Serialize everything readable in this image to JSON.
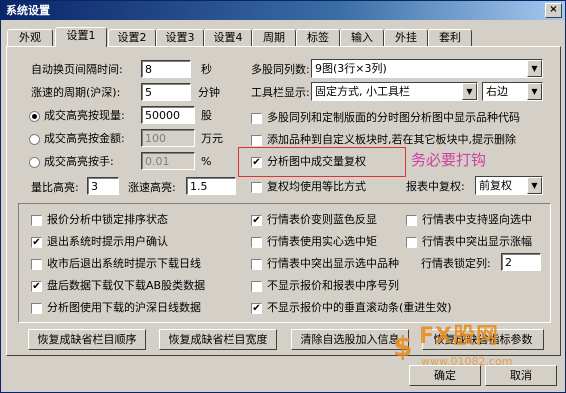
{
  "window": {
    "title": "系统设置",
    "close": "×"
  },
  "tabs": [
    "外观",
    "设置1",
    "设置2",
    "设置3",
    "设置4",
    "周期",
    "标签",
    "输入",
    "外挂",
    "套利"
  ],
  "left": {
    "refresh_label": "自动换页间隔时间:",
    "refresh_value": "8",
    "refresh_unit": "秒",
    "surge_label": "涨速的周期(沪深):",
    "surge_value": "5",
    "surge_unit": "分钟",
    "radio1_label": "成交高亮按现量:",
    "radio1_value": "50000",
    "radio1_unit": "股",
    "radio2_label": "成交高亮按金额:",
    "radio2_value": "100",
    "radio2_unit": "万元",
    "radio3_label": "成交高亮按手:",
    "radio3_value": "0.01",
    "radio3_unit": "%",
    "volratio_label": "量比高亮:",
    "volratio_value": "3",
    "surge_hl_label": "涨速高亮:",
    "surge_hl_value": "1.5"
  },
  "right": {
    "multi_label": "多股同列数:",
    "multi_value": "9图(3行×3列)",
    "toolbar_label": "工具栏显示:",
    "toolbar_value": "固定方式, 小工具栏",
    "toolbar_pos": "右边",
    "cb1": "多股同列和定制版面的分时图分析图中显示品种代码",
    "cb2": "添加品种到自定义板块时,若在其它板块中,提示删除",
    "cb3": "分析图中成交量复权",
    "cb4": "复权均使用等比方式",
    "fq_label": "报表中复权:",
    "fq_value": "前复权"
  },
  "annotation": "务必要打钩",
  "options": {
    "o1": "报价分析中锁定排序状态",
    "o2": "退出系统时提示用户确认",
    "o3": "收市后退出系统时提示下载日线",
    "o4": "盘后数据下载仅下载AB股类数据",
    "o5": "分析图使用下载的沪深日线数据",
    "o6": "行情表价变则蓝色反显",
    "o7": "行情表使用实心选中矩",
    "o8": "行情表中突出显示选中品种",
    "o9": "不显示报价和报表中序号列",
    "o10": "不显示报价中的垂直滚动条(重进生效)",
    "o11": "行情表中支持竖向选中",
    "o12": "行情表中突出显示涨幅",
    "lock_label": "行情表锁定列:",
    "lock_value": "2"
  },
  "buttons": {
    "b1": "恢复成缺省栏目顺序",
    "b2": "恢复成缺省栏目宽度",
    "b3": "清除自选股加入信息",
    "b4": "恢复成缺省指标参数",
    "ok": "确定",
    "cancel": "取消"
  },
  "watermark": {
    "brand": "FX股网",
    "url": "www.01082.com"
  }
}
